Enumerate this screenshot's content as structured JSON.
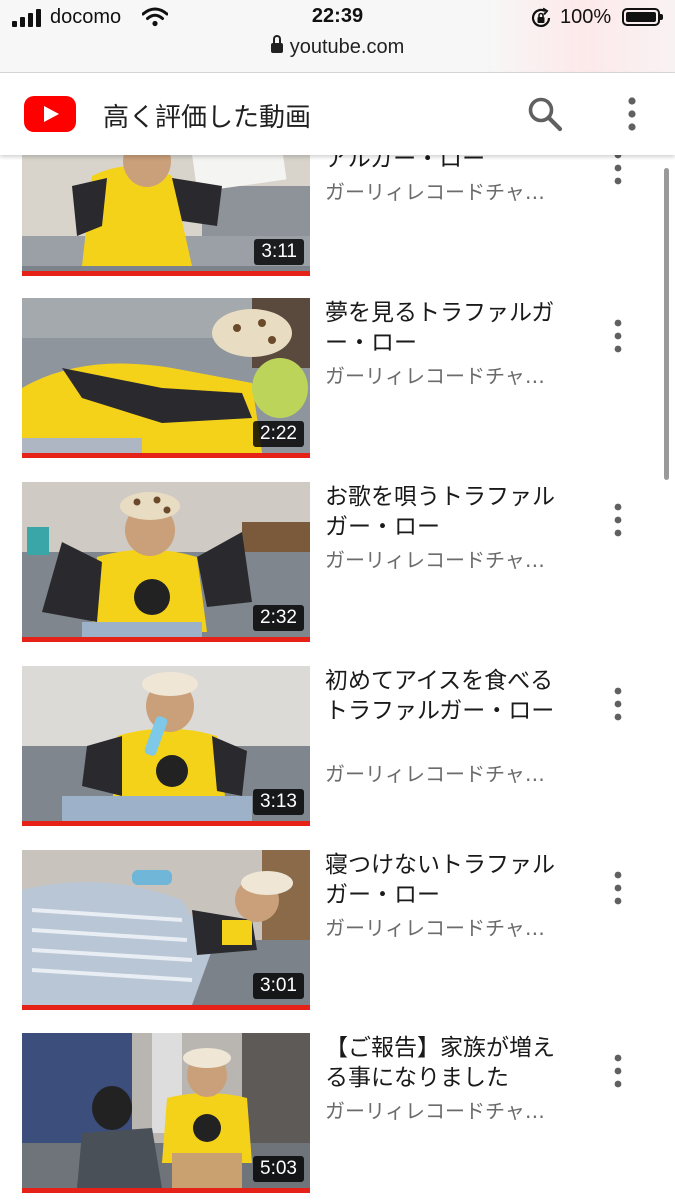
{
  "status_bar": {
    "carrier": "docomo",
    "time": "22:39",
    "battery": "100%",
    "url": "youtube.com",
    "icons": [
      "signal-icon",
      "wifi-icon",
      "rotation-lock-icon",
      "battery-icon",
      "padlock-icon"
    ]
  },
  "header": {
    "logo": "youtube-logo-icon",
    "title": "高く評価した動画",
    "search_icon": "search-icon",
    "more_icon": "vertical-dots-icon"
  },
  "colors": {
    "brand_red": "#ff0000",
    "progress_red": "#e62117",
    "shirt_yellow": "#f5d21a"
  },
  "videos": [
    {
      "title": "アルガー・ロー",
      "channel": "ガーリィレコードチャンネル",
      "duration": "3:11",
      "watched": 1.0
    },
    {
      "title": "夢を見るトラファルガー・ロー",
      "channel": "ガーリィレコードチャンネル",
      "duration": "2:22",
      "watched": 1.0
    },
    {
      "title": "お歌を唄うトラファルガー・ロー",
      "channel": "ガーリィレコードチャンネル",
      "duration": "2:32",
      "watched": 1.0
    },
    {
      "title": "初めてアイスを食べるトラファルガー・ロー",
      "channel": "ガーリィレコードチャンネル",
      "duration": "3:13",
      "watched": 1.0
    },
    {
      "title": "寝つけないトラファルガー・ロー",
      "channel": "ガーリィレコードチャンネル",
      "duration": "3:01",
      "watched": 1.0
    },
    {
      "title": "【ご報告】家族が増える事になりました",
      "channel": "ガーリィレコードチャンネル",
      "duration": "5:03",
      "watched": 1.0
    }
  ]
}
